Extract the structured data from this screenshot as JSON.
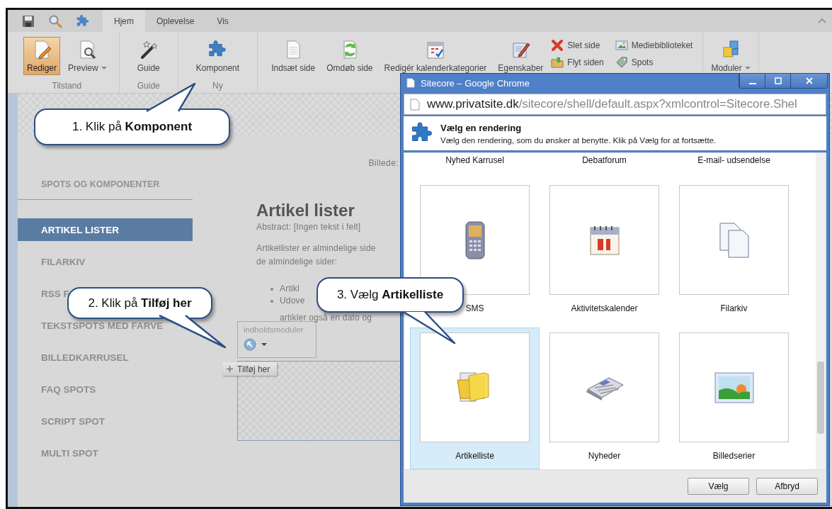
{
  "ribbon": {
    "tabs": [
      {
        "label": "Hjem",
        "selected": true
      },
      {
        "label": "Oplevelse",
        "selected": false
      },
      {
        "label": "Vis",
        "selected": false
      }
    ],
    "groups": [
      {
        "label": "Tilstand",
        "buttons": [
          {
            "label": "Rediger",
            "kind": "large",
            "active": true,
            "dropdown": false
          },
          {
            "label": "Preview",
            "kind": "large",
            "active": false,
            "dropdown": true
          }
        ]
      },
      {
        "label": "Guide",
        "buttons": [
          {
            "label": "Guide",
            "kind": "large",
            "active": false,
            "dropdown": false
          }
        ]
      },
      {
        "label": "Ny",
        "buttons": [
          {
            "label": "Komponent",
            "kind": "large",
            "active": false,
            "dropdown": false
          }
        ]
      },
      {
        "buttons": [
          {
            "label": "Indsæt side",
            "kind": "large",
            "active": false,
            "dropdown": false
          },
          {
            "label": "Omdøb side",
            "kind": "large",
            "active": false,
            "dropdown": false
          },
          {
            "label": "Redigér kalenderkategorier",
            "kind": "large",
            "active": false,
            "dropdown": false
          },
          {
            "label": "Egenskaber",
            "kind": "large",
            "active": false,
            "dropdown": false
          },
          {
            "label": "Slet side",
            "kind": "small",
            "active": false
          },
          {
            "label": "Flyt siden",
            "kind": "small",
            "active": false
          },
          {
            "label": "Mediebiblioteket",
            "kind": "small",
            "active": false
          },
          {
            "label": "Spots",
            "kind": "small",
            "active": false
          }
        ]
      },
      {
        "buttons": [
          {
            "label": "Moduler",
            "kind": "large",
            "active": false,
            "dropdown": true
          }
        ]
      }
    ]
  },
  "page": {
    "nav": {
      "heading": "SPOTS OG KOMPONENTER",
      "items": [
        {
          "label": "ARTIKEL LISTER",
          "selected": true
        },
        {
          "label": "FILARKIV",
          "selected": false
        },
        {
          "label": "RSS F",
          "selected": false
        },
        {
          "label": "TEKSTSPOTS MED FARVE",
          "selected": false
        },
        {
          "label": "BILLEDKARRUSEL",
          "selected": false
        },
        {
          "label": "FAQ SPOTS",
          "selected": false
        },
        {
          "label": "SCRIPT SPOT",
          "selected": false
        },
        {
          "label": "MULTI SPOT",
          "selected": false
        }
      ]
    },
    "image_label": "Billede:",
    "article": {
      "title": "Artikel lister",
      "abstract": "Abstract: [Ingen tekst i felt]",
      "intro": [
        "Artikellister er almindelige side",
        "de almindelige sider:"
      ],
      "bullets": [
        "Artikl",
        "Udove"
      ],
      "bullet_continuation": "artikler også en dato og"
    },
    "placeholder": {
      "label": "indholdsmoduler"
    },
    "add_button": "Tilføj her"
  },
  "dialog": {
    "title": "Sitecore – Google Chrome",
    "address": {
      "host": "www.privatsite.dk",
      "path": "/sitecore/shell/default.aspx?xmlcontrol=Sitecore.Shel"
    },
    "heading": "Vælg en rendering",
    "description": "Vælg den rendering, som du ønsker at benytte. Klik på Vælg for at fortsætte.",
    "cut_row": [
      "Nyhed Karrusel",
      "Debatforum",
      "E-mail- udsendelse"
    ],
    "renderings": [
      {
        "label": "SMS",
        "selected": false
      },
      {
        "label": "Aktivitetskalender",
        "selected": false
      },
      {
        "label": "Filarkiv",
        "selected": false
      },
      {
        "label": "Artikelliste",
        "selected": true
      },
      {
        "label": "Nyheder",
        "selected": false
      },
      {
        "label": "Billedserier",
        "selected": false
      }
    ],
    "buttons": [
      "Vælg",
      "Afbryd"
    ]
  },
  "callouts": [
    {
      "text": "1. Klik på **Komponent**"
    },
    {
      "text": "2. Klik på **Tilføj her**"
    },
    {
      "text": "3. Vælg **Artikelliste**"
    }
  ]
}
